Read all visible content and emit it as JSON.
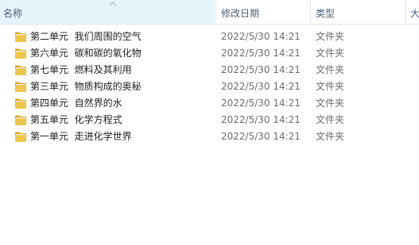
{
  "columns": {
    "name": "名称",
    "date": "修改日期",
    "type": "类型",
    "size": "大小"
  },
  "sort": {
    "column": "name",
    "icon": "sort-up-chevron-icon"
  },
  "icons": {
    "folder": "folder-icon"
  },
  "colors": {
    "header_text": "#4c607a",
    "folder_yellow": "#e8b83c",
    "secondary_text": "#6d6d6d"
  },
  "rows": [
    {
      "name": "第二单元  我们周围的空气",
      "date": "2022/5/30 14:21",
      "type": "文件夹"
    },
    {
      "name": "第六单元  碳和碳的氧化物",
      "date": "2022/5/30 14:21",
      "type": "文件夹"
    },
    {
      "name": "第七单元  燃料及其利用",
      "date": "2022/5/30 14:21",
      "type": "文件夹"
    },
    {
      "name": "第三单元  物质构成的奥秘",
      "date": "2022/5/30 14:21",
      "type": "文件夹"
    },
    {
      "name": "第四单元  自然界的水",
      "date": "2022/5/30 14:21",
      "type": "文件夹"
    },
    {
      "name": "第五单元  化学方程式",
      "date": "2022/5/30 14:21",
      "type": "文件夹"
    },
    {
      "name": "第一单元  走进化学世界",
      "date": "2022/5/30 14:21",
      "type": "文件夹"
    }
  ]
}
